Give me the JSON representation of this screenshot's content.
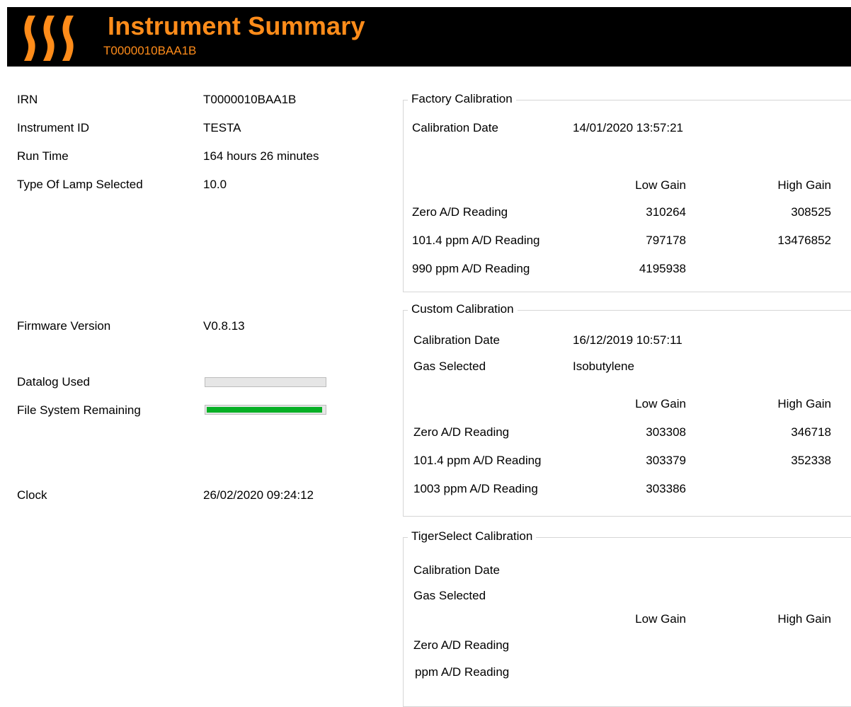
{
  "header": {
    "title": "Instrument Summary",
    "subtitle": "T0000010BAA1B",
    "logo_color": "#ff8c1a"
  },
  "info": {
    "irn_label": "IRN",
    "irn_value": "T0000010BAA1B",
    "instrument_id_label": "Instrument ID",
    "instrument_id_value": "TESTA",
    "run_time_label": "Run Time",
    "run_time_value": "164  hours 26 minutes",
    "lamp_label": "Type Of Lamp Selected",
    "lamp_value": "10.0",
    "firmware_label": "Firmware Version",
    "firmware_value": "V0.8.13",
    "datalog_label": "Datalog Used",
    "datalog_fraction": 0.0,
    "filesystem_label": "File System Remaining",
    "filesystem_fraction": 0.98,
    "clock_label": "Clock",
    "clock_value": "26/02/2020 09:24:12",
    "bar_fill_color": "#06b025"
  },
  "factory": {
    "title": "Factory Calibration",
    "date_label": "Calibration Date",
    "date_value": "14/01/2020 13:57:21",
    "col_low": "Low Gain",
    "col_high": "High Gain",
    "rows": [
      {
        "label": "Zero A/D Reading",
        "low": "310264",
        "high": "308525"
      },
      {
        "label": "101.4 ppm A/D Reading",
        "low": "797178",
        "high": "13476852"
      },
      {
        "label": "990 ppm A/D Reading",
        "low": "4195938",
        "high": ""
      }
    ]
  },
  "custom": {
    "title": "Custom Calibration",
    "date_label": "Calibration Date",
    "date_value": "16/12/2019 10:57:11",
    "gas_label": "Gas Selected",
    "gas_value": "Isobutylene",
    "col_low": "Low Gain",
    "col_high": "High Gain",
    "rows": [
      {
        "label": "Zero A/D Reading",
        "low": "303308",
        "high": "346718"
      },
      {
        "label": "101.4 ppm A/D Reading",
        "low": "303379",
        "high": "352338"
      },
      {
        "label": "1003 ppm A/D Reading",
        "low": "303386",
        "high": ""
      }
    ]
  },
  "tiger": {
    "title": "TigerSelect Calibration",
    "date_label": "Calibration Date",
    "gas_label": "Gas Selected",
    "col_low": "Low Gain",
    "col_high": "High Gain",
    "rows": [
      {
        "label": "Zero A/D Reading"
      },
      {
        "label": "ppm A/D Reading"
      }
    ]
  }
}
